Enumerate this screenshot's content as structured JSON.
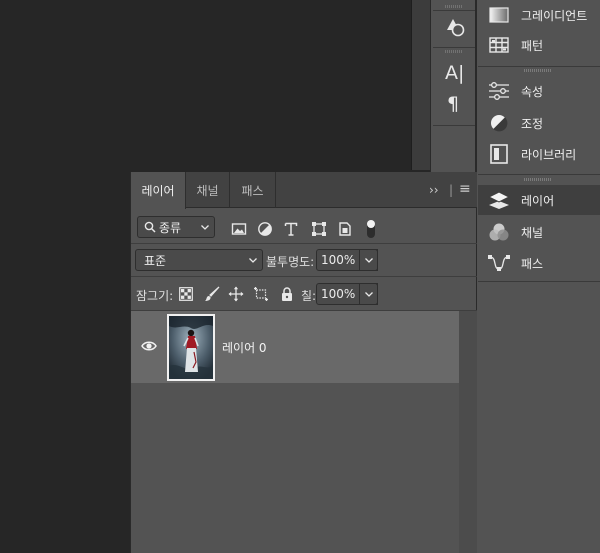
{
  "strip": {
    "tools": [
      {
        "icon": "shapes-icon"
      },
      {
        "icon": "character-icon",
        "glyph": "A|"
      },
      {
        "icon": "paragraph-icon",
        "glyph": "¶"
      }
    ]
  },
  "dock": {
    "items": [
      {
        "label": "그레이디언트",
        "icon": "gradient-icon"
      },
      {
        "label": "패턴",
        "icon": "pattern-icon"
      },
      {
        "label": "속성",
        "icon": "properties-icon"
      },
      {
        "label": "조정",
        "icon": "adjustments-icon"
      },
      {
        "label": "라이브러리",
        "icon": "libraries-icon"
      },
      {
        "label": "레이어",
        "icon": "layers-icon",
        "active": true
      },
      {
        "label": "채널",
        "icon": "channels-icon"
      },
      {
        "label": "패스",
        "icon": "paths-icon"
      }
    ]
  },
  "panel": {
    "tabs": [
      {
        "label": "레이어",
        "active": true
      },
      {
        "label": "채널"
      },
      {
        "label": "패스"
      }
    ],
    "collapse_glyph": "››",
    "menu_glyph": "≡",
    "filter": {
      "value": "종류",
      "icons": [
        "image-filter-icon",
        "adjustment-filter-icon",
        "type-filter-icon",
        "shape-filter-icon",
        "smart-object-filter-icon",
        "filter-toggle-icon"
      ]
    },
    "blend_mode": "표준",
    "opacity_label": "불투명도:",
    "opacity_value": "100%",
    "lock_label": "잠그기:",
    "fill_label": "칠:",
    "fill_value": "100%",
    "layers": [
      {
        "name": "레이어 0",
        "visible": true
      }
    ]
  },
  "colors": {
    "panel_bg": "#535353",
    "tab_bar": "#424242",
    "selected_layer": "#696969",
    "canvas_bg": "#262626"
  }
}
